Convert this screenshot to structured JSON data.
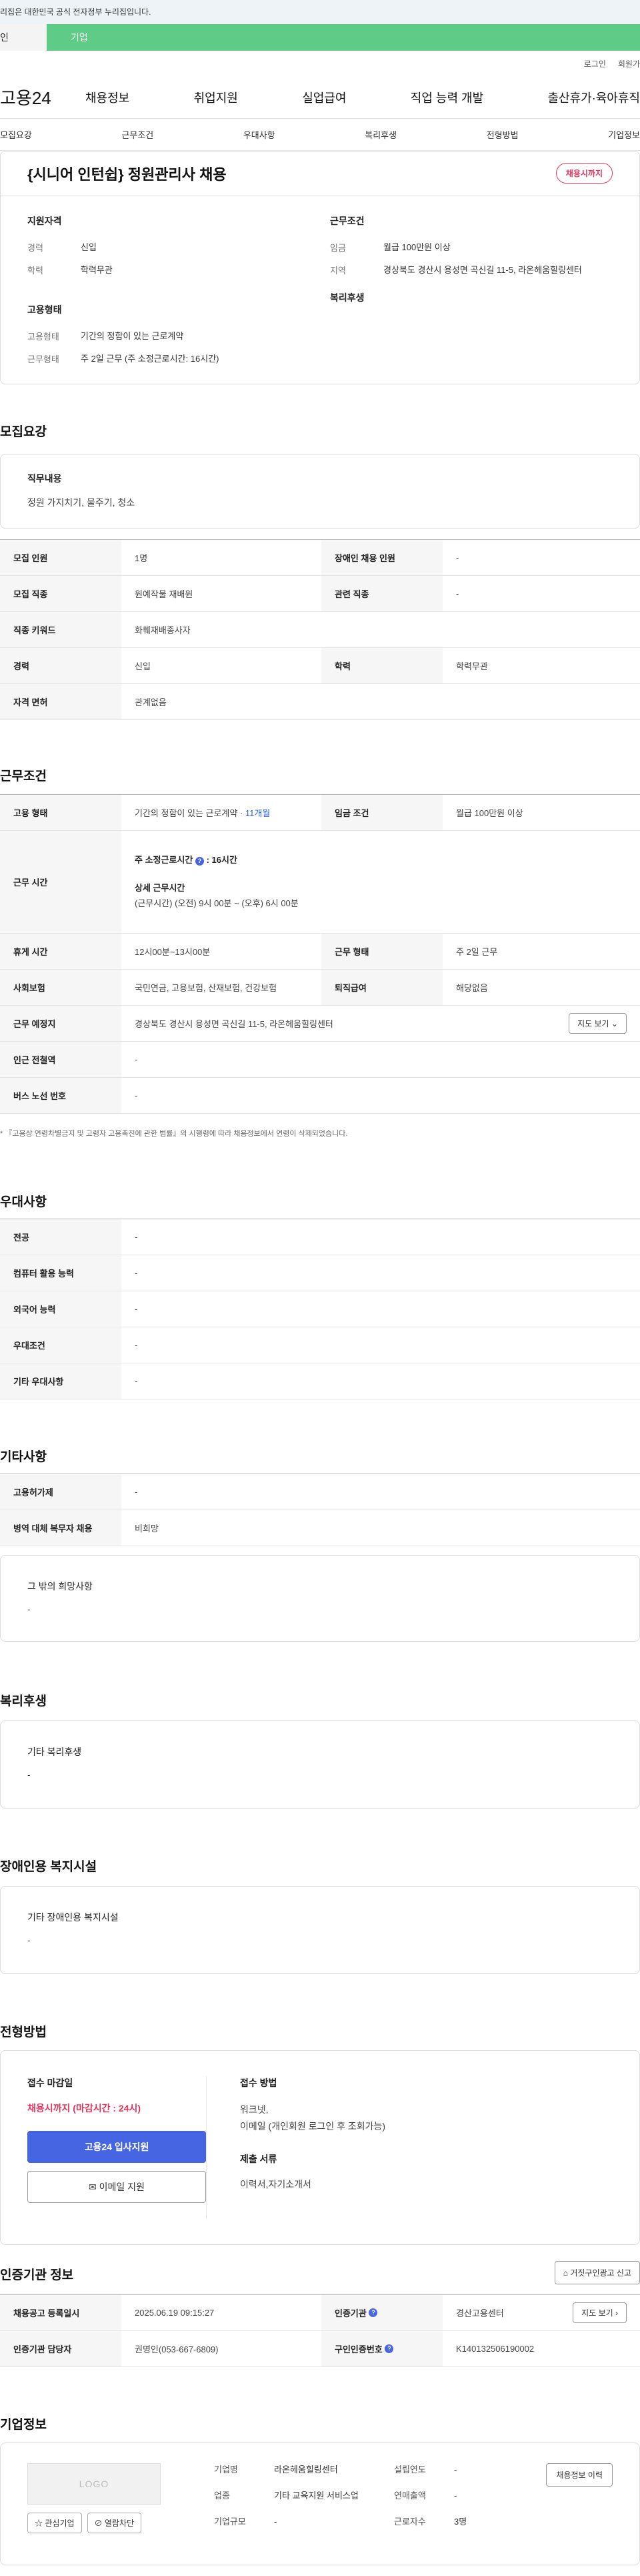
{
  "gov_banner": "리집은 대한민국 공식 전자정부 누리집입니다.",
  "tabs": {
    "t1": "인",
    "t2": "기업"
  },
  "top_links": {
    "login": "로그인",
    "join": "회원가"
  },
  "gnb": {
    "logo": "고용24",
    "menu": [
      "채용정보",
      "취업지원",
      "실업급여",
      "직업 능력 개발",
      "출산휴가·육아휴직"
    ]
  },
  "subnav": [
    "모집요강",
    "근무조건",
    "우대사항",
    "복리후생",
    "전형방법",
    "기업정보"
  ],
  "summary": {
    "title": "{시니어 인턴쉽} 정원관리사 채용",
    "badge": "채용시까지",
    "left": {
      "sec1": "지원자격",
      "rows1": [
        {
          "k": "경력",
          "v": "신입"
        },
        {
          "k": "학력",
          "v": "학력무관"
        }
      ],
      "sec2": "고용형태",
      "rows2": [
        {
          "k": "고용형태",
          "v": "기간의 정함이 있는 근로계약"
        },
        {
          "k": "근무형태",
          "v": "주 2일 근무 (주 소정근로시간: 16시간)"
        }
      ]
    },
    "right": {
      "sec1": "근무조건",
      "rows1": [
        {
          "k": "임금",
          "v": "월급 100만원 이상"
        },
        {
          "k": "지역",
          "v": "경상북도 경산시 용성면 곡신길 11-5, 라온헤움힐링센터"
        }
      ],
      "sec2": "복리후생"
    }
  },
  "recruit": {
    "title": "모집요강",
    "duty_label": "직무내용",
    "duty_value": "정원 가지치기, 물주기, 청소",
    "rows": {
      "r1": {
        "k1": "모집 인원",
        "v1": "1명",
        "k2": "장애인 채용 인원",
        "v2": "-"
      },
      "r2": {
        "k1": "모집 직종",
        "v1": "원예작물 재배원",
        "k2": "관련 직종",
        "v2": "-"
      },
      "r3": {
        "k1": "직종 키워드",
        "v1": "화훼재배종사자"
      },
      "r4": {
        "k1": "경력",
        "v1": "신입",
        "k2": "학력",
        "v2": "학력무관"
      },
      "r5": {
        "k1": "자격 면허",
        "v1": "관계없음"
      }
    }
  },
  "work": {
    "title": "근무조건",
    "r1": {
      "k1": "고용 형태",
      "v1": "기간의 정함이 있는 근로계약 · ",
      "v1_hl": "11개월",
      "k2": "임금 조건",
      "v2": "월급 100만원 이상"
    },
    "r2": {
      "k1": "근무 시간",
      "l1": "주 소정근로시간",
      "l1v": "16시간",
      "l2": "상세 근무시간",
      "l2v": "(근무시간) (오전) 9시 00분 ~ (오후) 6시 00분"
    },
    "r3": {
      "k1": "휴게 시간",
      "v1": "12시00분~13시00분",
      "k2": "근무 형태",
      "v2": "주 2일 근무"
    },
    "r4": {
      "k1": "사회보험",
      "v1": "국민연금, 고용보험, 산재보험, 건강보험",
      "k2": "퇴직급여",
      "v2": "해당없음"
    },
    "r5": {
      "k1": "근무 예정지",
      "v1": "경상북도 경산시 용성면 곡신길 11-5, 라온헤움힐링센터",
      "btn": "지도 보기"
    },
    "r6": {
      "k1": "인근 전철역",
      "v1": "-"
    },
    "r7": {
      "k1": "버스 노선 번호",
      "v1": "-"
    },
    "note": "* 『고용상 연령차별금지 및 고령자 고용촉진에 관한 법률』의 시행령에 따라 채용정보에서 연령이 삭제되었습니다."
  },
  "preference": {
    "title": "우대사항",
    "rows": [
      {
        "k": "전공",
        "v": "-"
      },
      {
        "k": "컴퓨터 활용 능력",
        "v": "-"
      },
      {
        "k": "외국어 능력",
        "v": "-"
      },
      {
        "k": "우대조건",
        "v": "-"
      },
      {
        "k": "기타 우대사항",
        "v": "-"
      }
    ]
  },
  "etc": {
    "title": "기타사항",
    "rows": [
      {
        "k": "고용허가제",
        "v": "-"
      },
      {
        "k": "병역 대체 복무자 채용",
        "v": "비희망"
      }
    ],
    "box_label": "그 밖의 희망사항",
    "box_value": "-"
  },
  "welfare": {
    "title": "복리후생",
    "label": "기타 복리후생",
    "value": "-"
  },
  "disabled": {
    "title": "장애인용 복지시설",
    "label": "기타 장애인용 복지시설",
    "value": "-"
  },
  "apply": {
    "title": "전형방법",
    "deadline_label": "접수 마감일",
    "deadline_value": "채용시까지 (마감시간 : 24시)",
    "primary_btn": "고용24 입사지원",
    "secondary_btn": "이메일 지원",
    "method_label": "접수 방법",
    "method_v1": "워크넷,",
    "method_v2": "이메일 (개인회원 로그인 후 조회가능)",
    "docs_label": "제출 서류",
    "docs_value": "이력서,자기소개서"
  },
  "cert": {
    "title": "인증기관 정보",
    "report_btn": "거짓구인광고 신고",
    "r1": {
      "k1": "채용공고 등록일시",
      "v1": "2025.06.19 09:15:27",
      "k2": "인증기관",
      "v2": "경산고용센터",
      "btn": "지도 보기"
    },
    "r2": {
      "k1": "인증기관 담당자",
      "v1": "권명인(053-667-6809)",
      "k2": "구인인증번호",
      "v2": "K140132506190002"
    }
  },
  "company": {
    "title": "기업정보",
    "logo_text": "LOGO",
    "interest_btn": "관심기업",
    "block_btn": "열람차단",
    "history_btn": "채용정보 이력",
    "col1": [
      {
        "k": "기업명",
        "v": "라온헤움힐링센터"
      },
      {
        "k": "업종",
        "v": "기타 교육지원 서비스업"
      },
      {
        "k": "기업규모",
        "v": "-"
      }
    ],
    "col2": [
      {
        "k": "설립연도",
        "v": "-"
      },
      {
        "k": "연매출액",
        "v": "-"
      },
      {
        "k": "근로자수",
        "v": "3명"
      }
    ]
  }
}
